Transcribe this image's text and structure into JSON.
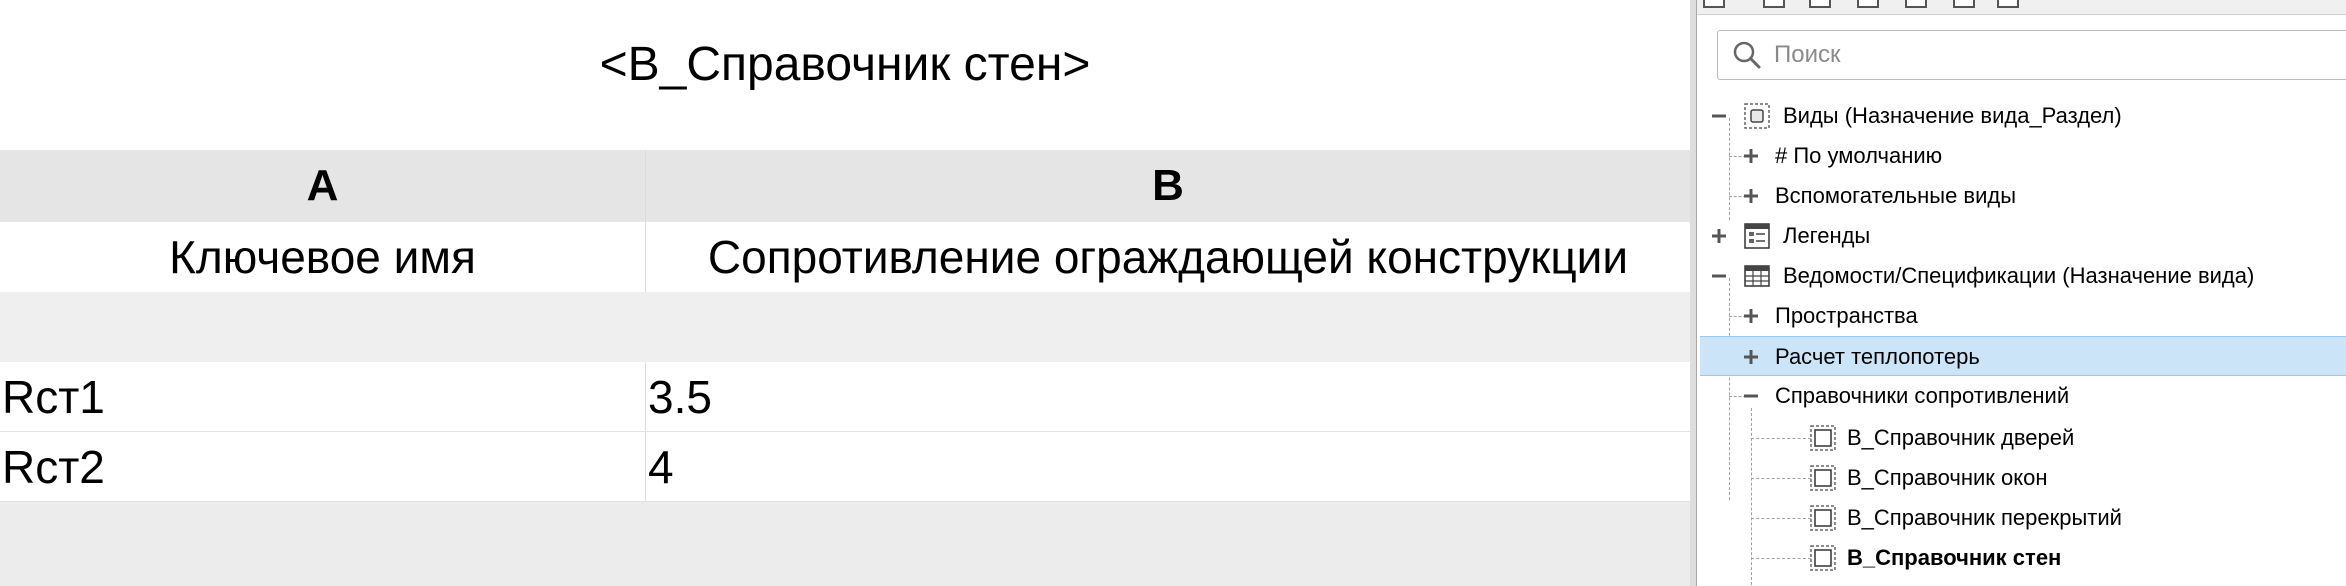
{
  "schedule": {
    "title": "<В_Справочник стен>",
    "column_letters": [
      "A",
      "B"
    ],
    "column_names": [
      "Ключевое имя",
      "Сопротивление ограждающей конструкции"
    ],
    "rows": [
      {
        "key": "Rст1",
        "value": "3.5"
      },
      {
        "key": "Rст2",
        "value": "4"
      }
    ]
  },
  "browser": {
    "search_placeholder": "Поиск",
    "tree": {
      "views": "Виды (Назначение вида_Раздел)",
      "default": "# По умолчанию",
      "auxiliary": "Вспомогательные виды",
      "legends": "Легенды",
      "schedules": "Ведомости/Спецификации (Назначение вида)",
      "spaces": "Пространства",
      "heat_loss": "Расчет теплопотерь",
      "resistance_refs": "Справочники сопротивлений",
      "doors": "В_Справочник дверей",
      "windows": "В_Справочник окон",
      "floors": "В_Справочник перекрытий",
      "walls": "В_Справочник стен"
    }
  },
  "colors": {
    "header_bg": "#e6e5e6",
    "selection_bg": "#cce4f7",
    "selection_border": "#99c9ef"
  }
}
